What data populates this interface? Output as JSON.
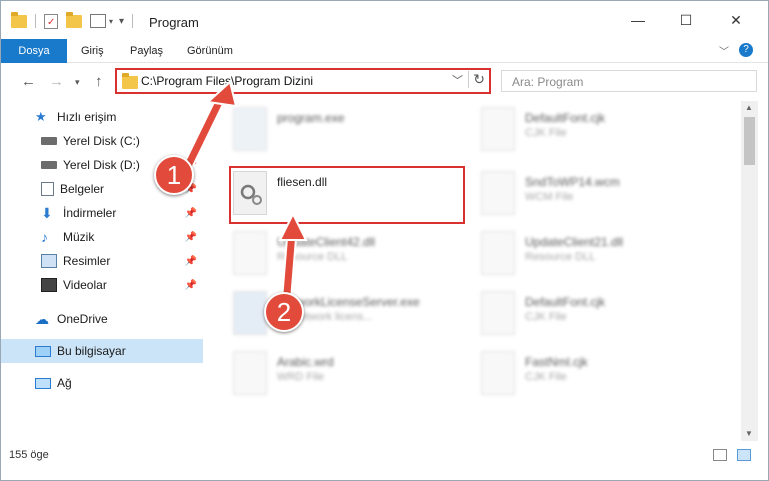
{
  "window": {
    "title": "Program"
  },
  "ribbon": {
    "tabs": [
      "Dosya",
      "Giriş",
      "Paylaş",
      "Görünüm"
    ]
  },
  "address": {
    "path": "C:\\Program Files\\Program Dizini",
    "search_placeholder": "Ara: Program"
  },
  "sidebar": {
    "items": [
      {
        "label": "Hızlı erişim",
        "icon": "star-icon"
      },
      {
        "label": "Yerel Disk (C:)",
        "icon": "drive-icon"
      },
      {
        "label": "Yerel Disk (D:)",
        "icon": "drive-icon"
      },
      {
        "label": "Belgeler",
        "icon": "documents-icon"
      },
      {
        "label": "İndirmeler",
        "icon": "download-icon"
      },
      {
        "label": "Müzik",
        "icon": "music-icon"
      },
      {
        "label": "Resimler",
        "icon": "pictures-icon"
      },
      {
        "label": "Videolar",
        "icon": "video-icon"
      },
      {
        "label": "OneDrive",
        "icon": "cloud-icon"
      },
      {
        "label": "Bu bilgisayar",
        "icon": "computer-icon"
      },
      {
        "label": "Ağ",
        "icon": "network-icon"
      }
    ]
  },
  "files": [
    {
      "name": "program.exe",
      "desc": ""
    },
    {
      "name": "DefaultFont.cjk",
      "desc": "CJK File"
    },
    {
      "name": "fliesen.dll",
      "desc": ""
    },
    {
      "name": "SndToWP14.wcm",
      "desc": "WCM File"
    },
    {
      "name": "UpdateClient42.dll",
      "desc": "Resource DLL"
    },
    {
      "name": "UpdateClient21.dll",
      "desc": "Resource DLL"
    },
    {
      "name": "NetworkLicenseServer.exe",
      "desc": "TF network licens..."
    },
    {
      "name": "DefaultFont.cjk",
      "desc": "CJK File"
    },
    {
      "name": "Arabic.wrd",
      "desc": "WRD File"
    },
    {
      "name": "FastNml.cjk",
      "desc": "CJK File"
    }
  ],
  "status": {
    "count": "155 öge"
  },
  "annotations": {
    "step1": "1",
    "step2": "2",
    "accent": "#e24a3b"
  }
}
